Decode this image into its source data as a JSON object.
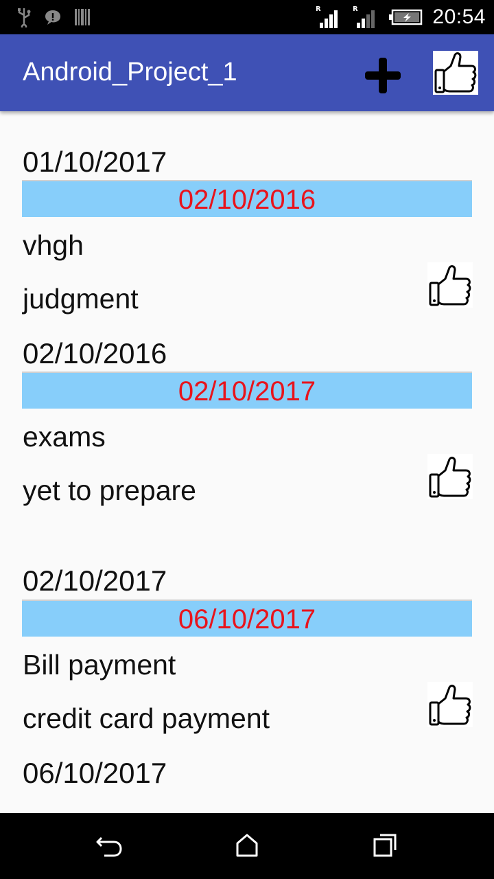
{
  "status_bar": {
    "time": "20:54",
    "left_icons": [
      "usb-icon",
      "chat-notification-icon",
      "barcode-icon"
    ],
    "right_icons": [
      "signal-r-icon",
      "signal-r-icon",
      "battery-charging-icon"
    ]
  },
  "app_bar": {
    "title": "Android_Project_1",
    "add_icon": "plus-icon",
    "like_icon": "thumbs-up-icon"
  },
  "entries": [
    {
      "start_date": "01/10/2017",
      "due_date": "02/10/2016",
      "title": "vhgh",
      "description": "judgment"
    },
    {
      "start_date": "02/10/2016",
      "due_date": "02/10/2017",
      "title": "exams",
      "description": "yet to prepare"
    },
    {
      "start_date": "02/10/2017",
      "due_date": "06/10/2017",
      "title": "Bill payment",
      "description": "credit card payment"
    },
    {
      "start_date": "06/10/2017"
    }
  ],
  "nav_bar": {
    "back_icon": "back-icon",
    "home_icon": "home-icon",
    "recents_icon": "recents-icon"
  },
  "colors": {
    "app_bar": "#3f51b5",
    "date_bar": "#87cefa",
    "due_date_text": "#e8141c"
  }
}
